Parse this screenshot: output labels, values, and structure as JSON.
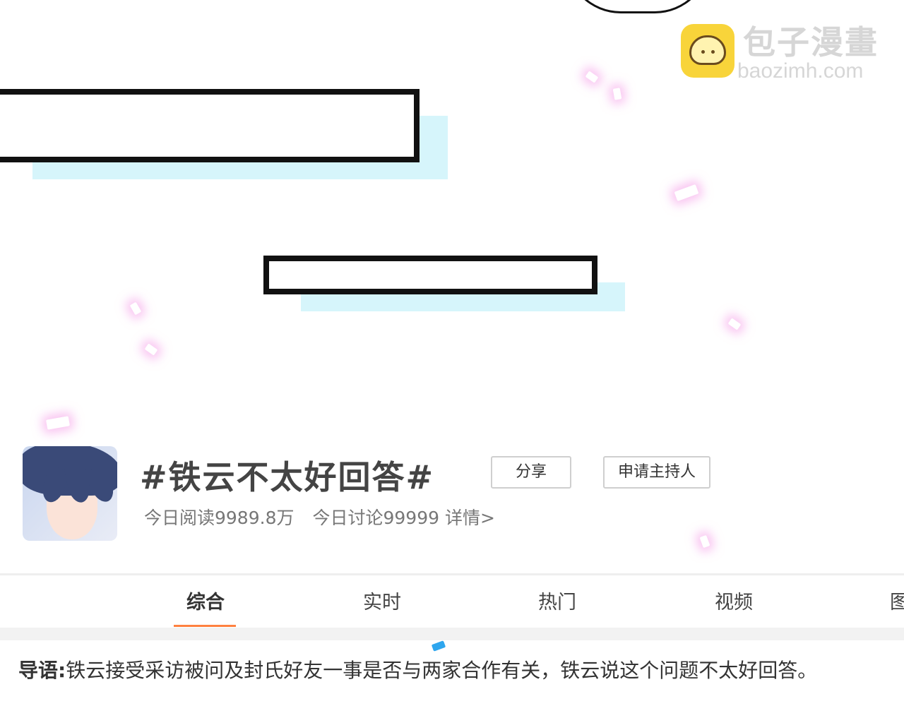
{
  "watermark": {
    "name": "包子漫畫",
    "url": "baozimh.com"
  },
  "topic": {
    "title": "#铁云不太好回答#",
    "reads": "今日阅读9989.8万",
    "discussions": "今日讨论99999",
    "details_link": "详情>",
    "share_label": "分享",
    "host_label": "申请主持人"
  },
  "tabs": [
    {
      "label": "综合",
      "active": true
    },
    {
      "label": "实时",
      "active": false
    },
    {
      "label": "热门",
      "active": false
    },
    {
      "label": "视频",
      "active": false
    },
    {
      "label": "图",
      "active": false
    }
  ],
  "intro": {
    "label": "导语:",
    "text": "铁云接受采访被问及封氏好友一事是否与两家合作有关，铁云说这个问题不太好回答。"
  },
  "colors": {
    "tab_active_underline": "#ff8140",
    "caption_shadow": "#d6f5fb",
    "petal_glow": "#f496e6"
  }
}
